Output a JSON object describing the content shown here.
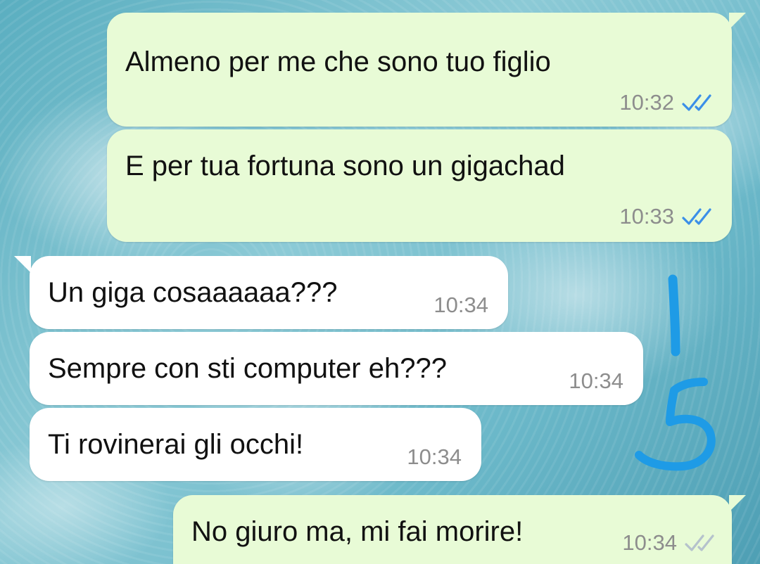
{
  "chat": {
    "messages": [
      {
        "direction": "outgoing",
        "text": "Almeno per me che sono tuo figlio",
        "time": "10:32",
        "status": "read",
        "status_icon": "double-check-icon"
      },
      {
        "direction": "outgoing",
        "text": "E per tua fortuna sono un gigachad",
        "time": "10:33",
        "status": "read",
        "status_icon": "double-check-icon"
      },
      {
        "direction": "incoming",
        "text": "Un giga cosaaaaaa???",
        "time": "10:34"
      },
      {
        "direction": "incoming",
        "text": "Sempre con sti computer eh???",
        "time": "10:34"
      },
      {
        "direction": "incoming",
        "text": "Ti rovinerai gli occhi!",
        "time": "10:34"
      },
      {
        "direction": "outgoing",
        "text": "No giuro ma, mi fai morire!",
        "time": "10:34",
        "status": "delivered",
        "status_icon": "double-check-icon"
      }
    ]
  },
  "annotation": {
    "text": "1 5",
    "color": "#1e9be6"
  },
  "colors": {
    "outgoing_bubble": "#e8fbd6",
    "incoming_bubble": "#ffffff",
    "read_tick": "#3b8fe8",
    "time_text": "#8d8d8d"
  }
}
